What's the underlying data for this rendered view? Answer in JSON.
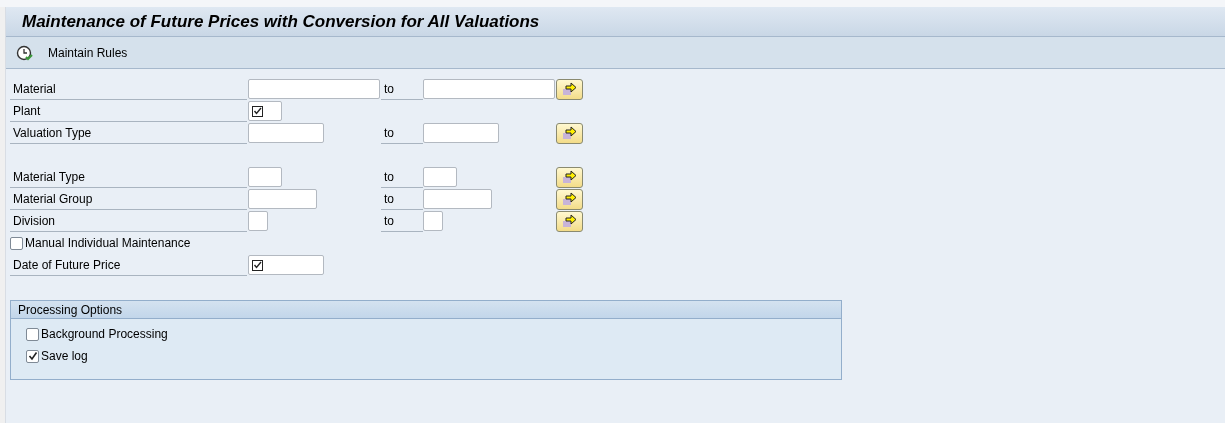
{
  "window": {
    "title": "Maintenance of Future Prices with Conversion for All Valuations"
  },
  "toolbar": [
    {
      "label": "Maintain Rules"
    }
  ],
  "selection_blocks": [
    [
      {
        "kind": "range",
        "label": "Material",
        "to": "to"
      },
      {
        "kind": "single",
        "label": "Plant",
        "required": true
      },
      {
        "kind": "range",
        "label": "Valuation Type",
        "to": "to"
      }
    ],
    [
      {
        "kind": "range",
        "label": "Material Type",
        "to": "to"
      },
      {
        "kind": "range",
        "label": "Material Group",
        "to": "to"
      },
      {
        "kind": "range",
        "label": "Division",
        "to": "to"
      },
      {
        "kind": "checkbox",
        "label": "Manual Individual Maintenance",
        "checked": false
      },
      {
        "kind": "single",
        "label": "Date of Future Price",
        "required": true
      }
    ]
  ],
  "processing_options": {
    "title": "Processing Options",
    "options": [
      {
        "label": "Background Processing",
        "checked": false
      },
      {
        "label": "Save log",
        "checked": true
      }
    ]
  }
}
